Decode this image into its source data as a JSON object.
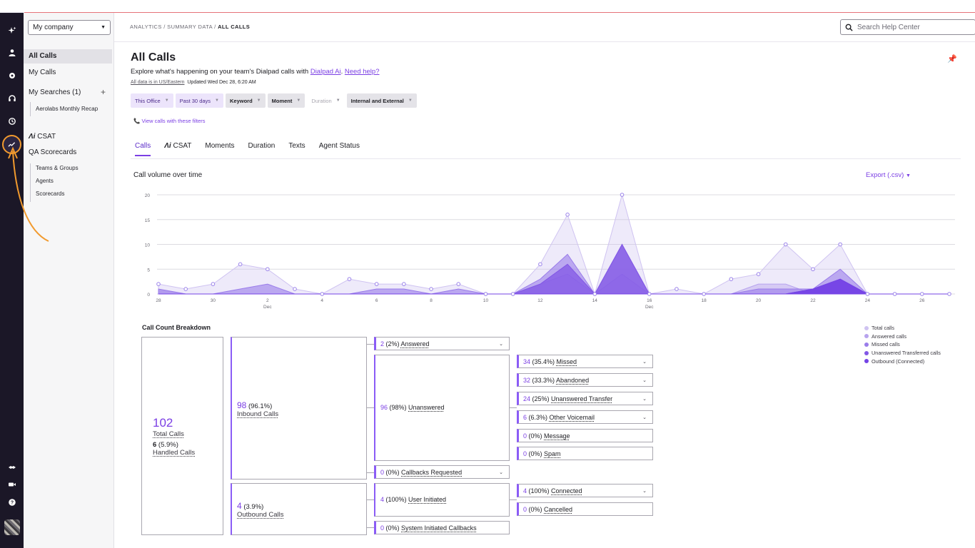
{
  "breadcrumb": {
    "prefix": "ANALYTICS / SUMMARY DATA / ",
    "current": "ALL CALLS"
  },
  "search": {
    "placeholder": "Search Help Center"
  },
  "sidebar": {
    "company": "My company",
    "items": {
      "all_calls": "All Calls",
      "my_calls": "My Calls",
      "my_searches": "My Searches (1)",
      "add": "+",
      "saved_search": "Aerolabs Monthly Recap",
      "csat": "CSAT",
      "ai_mark": "Λi",
      "qa_scorecards": "QA Scorecards",
      "teams_groups": "Teams & Groups",
      "agents": "Agents",
      "scorecards": "Scorecards"
    }
  },
  "page": {
    "title": "All Calls",
    "subtitle_text": "Explore what's happening on your team's Dialpad calls with ",
    "dialpad_ai": "Dialpad Ai",
    "sep": ". ",
    "need_help": "Need help?",
    "timezone": "All data is in US/Eastern",
    "updated": "Updated Wed Dec 28, 6:20 AM",
    "view_calls": "View calls with these filters"
  },
  "filters": [
    {
      "label": "This Office",
      "style": "purple"
    },
    {
      "label": "Past 30 days",
      "style": "purple"
    },
    {
      "label": "Keyword",
      "style": "gray"
    },
    {
      "label": "Moment",
      "style": "gray"
    },
    {
      "label": "Duration",
      "style": "dis"
    },
    {
      "label": "Internal and External",
      "style": "gray"
    }
  ],
  "tabs": [
    "Calls",
    "CSAT",
    "Moments",
    "Duration",
    "Texts",
    "Agent Status"
  ],
  "chart_title": "Call volume over time",
  "export_label": "Export (.csv)",
  "chart_data": {
    "type": "area",
    "x": [
      "28",
      "29",
      "30",
      "1",
      "2",
      "3",
      "4",
      "5",
      "6",
      "7",
      "8",
      "9",
      "10",
      "11",
      "12",
      "13",
      "14",
      "15",
      "16",
      "17",
      "18",
      "19",
      "20",
      "21",
      "22",
      "23",
      "24",
      "25",
      "26",
      "27"
    ],
    "x_tick_labels": [
      "28",
      "30",
      "2",
      "4",
      "6",
      "8",
      "10",
      "12",
      "14",
      "16",
      "18",
      "20",
      "22",
      "24",
      "26"
    ],
    "x_month_labels": [
      {
        "at": "2",
        "label": "Dec"
      },
      {
        "at": "16",
        "label": "Dec"
      }
    ],
    "y_ticks": [
      0,
      5,
      10,
      15,
      20
    ],
    "ylim": [
      0,
      20
    ],
    "series": [
      {
        "name": "Total calls",
        "color": "#cfc3f1",
        "values": [
          2,
          1,
          2,
          6,
          5,
          1,
          0,
          3,
          2,
          2,
          1,
          2,
          0,
          0,
          6,
          16,
          0,
          20,
          0,
          1,
          0,
          3,
          4,
          10,
          5,
          10,
          0,
          0,
          0,
          0
        ]
      },
      {
        "name": "Answered calls",
        "color": "#b7a3ee",
        "values": [
          1,
          0,
          0,
          0,
          0,
          0,
          0,
          0,
          0,
          0,
          0,
          0,
          0,
          0,
          2,
          4,
          0,
          4,
          0,
          0,
          0,
          0,
          2,
          2,
          0,
          2,
          0,
          0,
          0,
          0
        ]
      },
      {
        "name": "Missed calls",
        "color": "#9a7cea",
        "values": [
          1,
          0,
          0,
          1,
          2,
          0,
          0,
          0,
          1,
          1,
          0,
          1,
          0,
          0,
          3,
          8,
          0,
          10,
          0,
          0,
          0,
          0,
          1,
          1,
          1,
          5,
          0,
          0,
          0,
          0
        ]
      },
      {
        "name": "Unanswered Transferred calls",
        "color": "#8257e6",
        "values": [
          0,
          0,
          0,
          0,
          0,
          0,
          0,
          0,
          0,
          0,
          0,
          0,
          0,
          0,
          2,
          6,
          0,
          10,
          0,
          0,
          0,
          0,
          0,
          0,
          1,
          3,
          0,
          0,
          0,
          0
        ]
      },
      {
        "name": "Outbound (Connected)",
        "color": "#7443e6",
        "values": [
          0,
          0,
          0,
          0,
          0,
          0,
          0,
          0,
          0,
          0,
          0,
          0,
          0,
          0,
          0,
          0,
          0,
          0,
          0,
          0,
          0,
          0,
          0,
          0,
          1,
          3,
          0,
          0,
          0,
          0
        ]
      }
    ]
  },
  "breakdown": {
    "title": "Call Count Breakdown",
    "total": {
      "count": "102",
      "label": "Total Calls",
      "handled_count": "6",
      "handled_pct": " (5.9%)",
      "handled_label": "Handled Calls"
    },
    "inbound": {
      "count": "98",
      "pct": " (96.1%)",
      "label": "Inbound Calls"
    },
    "outbound": {
      "count": "4",
      "pct": " (3.9%)",
      "label": "Outbound Calls"
    },
    "answered": {
      "count": "2",
      "pct": " (2%) ",
      "label": "Answered"
    },
    "unanswered": {
      "count": "96",
      "pct": " (98%) ",
      "label": "Unanswered"
    },
    "callbacks": {
      "count": "0",
      "pct": " (0%) ",
      "label": "Callbacks Requested"
    },
    "user_initiated": {
      "count": "4",
      "pct": " (100%) ",
      "label": "User Initiated"
    },
    "system_callbacks": {
      "count": "0",
      "pct": " (0%) ",
      "label": "System Initiated Callbacks"
    },
    "missed": {
      "count": "34",
      "pct": " (35.4%) ",
      "label": "Missed"
    },
    "abandoned": {
      "count": "32",
      "pct": " (33.3%) ",
      "label": "Abandoned"
    },
    "unans_transfer": {
      "count": "24",
      "pct": " (25%) ",
      "label": "Unanswered Transfer"
    },
    "other_vm": {
      "count": "6",
      "pct": " (6.3%) ",
      "label": "Other Voicemail"
    },
    "message": {
      "count": "0",
      "pct": " (0%) ",
      "label": "Message"
    },
    "spam": {
      "count": "0",
      "pct": " (0%) ",
      "label": "Spam"
    },
    "connected": {
      "count": "4",
      "pct": " (100%) ",
      "label": "Connected"
    },
    "cancelled": {
      "count": "0",
      "pct": " (0%) ",
      "label": "Cancelled"
    }
  }
}
